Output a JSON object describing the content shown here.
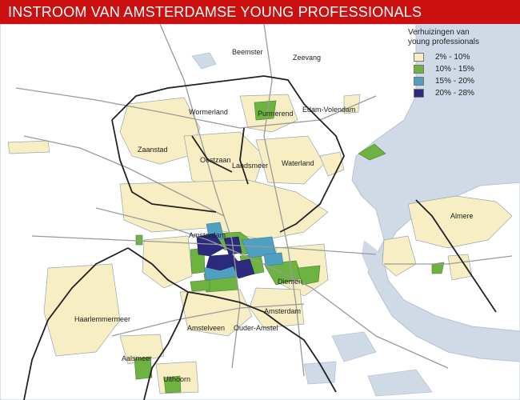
{
  "title": "INSTROOM VAN AMSTERDAMSE YOUNG PROFESSIONALS",
  "colors": {
    "title_bar": "#cc1010",
    "water": "#cfdae6",
    "land": "#ffffff",
    "municipality_border": "#222222",
    "road": "#9a9a9a",
    "district_outline": "#9aa6b0",
    "class_2_10": "#f7efc3",
    "class_10_15": "#6db33f",
    "class_15_20": "#4f9fc0",
    "class_20_28": "#2b2a7c"
  },
  "legend": {
    "title_line1": "Verhuizingen van",
    "title_line2": "young professionals",
    "items": [
      {
        "label": "2% - 10%",
        "color": "#f7efc3"
      },
      {
        "label": "10% - 15%",
        "color": "#6db33f"
      },
      {
        "label": "15% - 20%",
        "color": "#4f9fc0"
      },
      {
        "label": "20% - 28%",
        "color": "#2b2a7c"
      }
    ]
  },
  "places": {
    "beemster": "Beemster",
    "zeevang": "Zeevang",
    "wormerland": "Wormerland",
    "purmerend": "Purmerend",
    "edam_volendam": "Edam-Volendam",
    "zaanstad": "Zaanstad",
    "oostzaan": "Oostzaan",
    "landsmeer": "Landsmeer",
    "waterland": "Waterland",
    "almere": "Almere",
    "amsterdam_center": "Amsterdam",
    "diemen": "Diemen",
    "amsterdam": "Amsterdam",
    "haarlemmermeer": "Haarlemmermeer",
    "amstelveen": "Amstelveen",
    "ouder_amstel": "Ouder-Amstel",
    "aalsmeer": "Aalsmeer",
    "uithoorn": "Uithoorn"
  }
}
